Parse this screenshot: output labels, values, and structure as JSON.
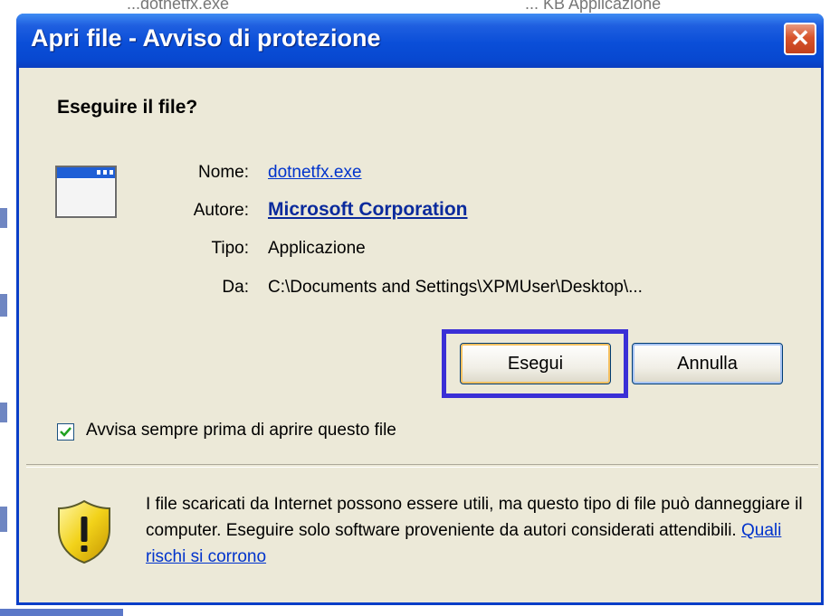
{
  "background": {
    "text_left": "...dotnetfx.exe",
    "text_right": "... KB   Applicazione"
  },
  "dialog": {
    "title": "Apri file - Avviso di protezione",
    "close_label": "✕",
    "heading": "Eseguire il file?",
    "fields": {
      "name_label": "Nome:",
      "name_value": "dotnetfx.exe",
      "author_label": "Autore:",
      "author_value": "Microsoft Corporation",
      "type_label": "Tipo:",
      "type_value": "Applicazione",
      "from_label": "Da:",
      "from_value": "C:\\Documents and Settings\\XPMUser\\Desktop\\..."
    },
    "buttons": {
      "run": "Esegui",
      "cancel": "Annulla"
    },
    "checkbox": {
      "label": "Avvisa sempre prima di aprire questo file",
      "checked": true
    },
    "warning": {
      "text": "I file scaricati da Internet possono essere utili, ma questo tipo di file può danneggiare il computer. Eseguire solo software proveniente da autori considerati attendibili. ",
      "link": "Quali rischi si corrono"
    },
    "icons": {
      "app": "application-window-icon",
      "shield": "security-shield-icon",
      "check": "checkmark-icon"
    },
    "colors": {
      "titlebar": "#0a4ed8",
      "focus_highlight": "#3a2fd6",
      "link": "#0033cc",
      "face": "#ece9d8"
    }
  }
}
